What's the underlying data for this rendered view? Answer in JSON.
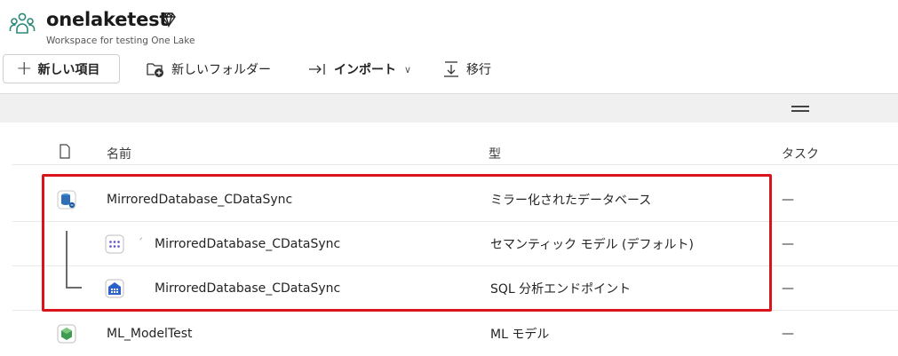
{
  "workspace": {
    "name": "onelaketest",
    "description": "Workspace for testing One Lake",
    "icon": "workspace-people-icon",
    "badge_icon": "diamond-icon"
  },
  "toolbar": {
    "new_item": "新しい項目",
    "new_folder": "新しいフォルダー",
    "import": "インポート",
    "migrate": "移行"
  },
  "table": {
    "headers": {
      "name": "名前",
      "type": "型",
      "task": "タスク"
    },
    "rows": [
      {
        "name": "MirroredDatabase_CDataSync",
        "type": "ミラー化されたデータベース",
        "task": "—",
        "icon": "mirrored-database-icon"
      },
      {
        "name": "MirroredDatabase_CDataSync",
        "type": "セマンティック モデル (デフォルト)",
        "task": "—",
        "icon": "semantic-model-icon"
      },
      {
        "name": "MirroredDatabase_CDataSync",
        "type": "SQL 分析エンドポイント",
        "task": "—",
        "icon": "sql-endpoint-icon"
      },
      {
        "name": "ML_ModelTest",
        "type": "ML モデル",
        "task": "—",
        "icon": "ml-model-icon"
      }
    ]
  },
  "colors": {
    "highlight": "#d9141c",
    "workspace_icon": "#2a8a7a",
    "band": "#f0f0f0"
  }
}
